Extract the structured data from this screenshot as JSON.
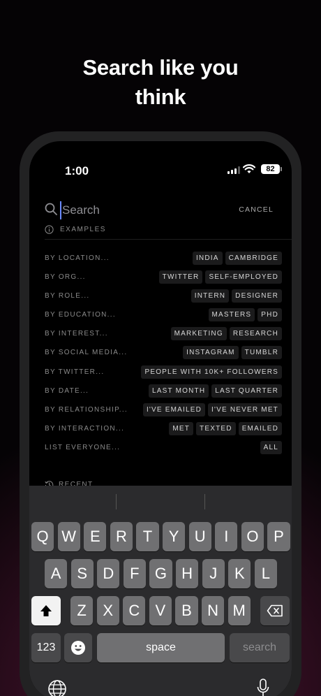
{
  "headline": {
    "line1": "Search like you",
    "line2": "think"
  },
  "status": {
    "time": "1:00",
    "battery": "82"
  },
  "search": {
    "placeholder": "Search",
    "cancel": "CANCEL"
  },
  "examples_label": "EXAMPLES",
  "rows": [
    {
      "label": "BY LOCATION...",
      "chips": [
        "INDIA",
        "CAMBRIDGE"
      ]
    },
    {
      "label": "BY ORG...",
      "chips": [
        "TWITTER",
        "SELF-EMPLOYED"
      ]
    },
    {
      "label": "BY ROLE...",
      "chips": [
        "INTERN",
        "DESIGNER"
      ]
    },
    {
      "label": "BY EDUCATION...",
      "chips": [
        "MASTERS",
        "PHD"
      ]
    },
    {
      "label": "BY INTEREST...",
      "chips": [
        "MARKETING",
        "RESEARCH"
      ]
    },
    {
      "label": "BY SOCIAL MEDIA...",
      "chips": [
        "INSTAGRAM",
        "TUMBLR"
      ]
    },
    {
      "label": "BY TWITTER...",
      "chips": [
        "PEOPLE WITH 10K+ FOLLOWERS"
      ]
    },
    {
      "label": "BY DATE...",
      "chips": [
        "LAST MONTH",
        "LAST QUARTER"
      ]
    },
    {
      "label": "BY RELATIONSHIP...",
      "chips": [
        "I'VE EMAILED",
        "I'VE NEVER MET"
      ]
    },
    {
      "label": "BY INTERACTION...",
      "chips": [
        "MET",
        "TEXTED",
        "EMAILED"
      ]
    },
    {
      "label": "LIST EVERYONE...",
      "chips": [
        "ALL"
      ]
    }
  ],
  "recent_label": "RECENT",
  "keyboard": {
    "row1": [
      "Q",
      "W",
      "E",
      "R",
      "T",
      "Y",
      "U",
      "I",
      "O",
      "P"
    ],
    "row2": [
      "A",
      "S",
      "D",
      "F",
      "G",
      "H",
      "J",
      "K",
      "L"
    ],
    "row3": [
      "Z",
      "X",
      "C",
      "V",
      "B",
      "N",
      "M"
    ],
    "numbers": "123",
    "space": "space",
    "search": "search",
    "icons": {
      "shift": "shift-arrow-icon",
      "delete": "backspace-icon",
      "emoji": "emoji-icon",
      "globe": "globe-icon",
      "mic": "microphone-icon"
    }
  }
}
